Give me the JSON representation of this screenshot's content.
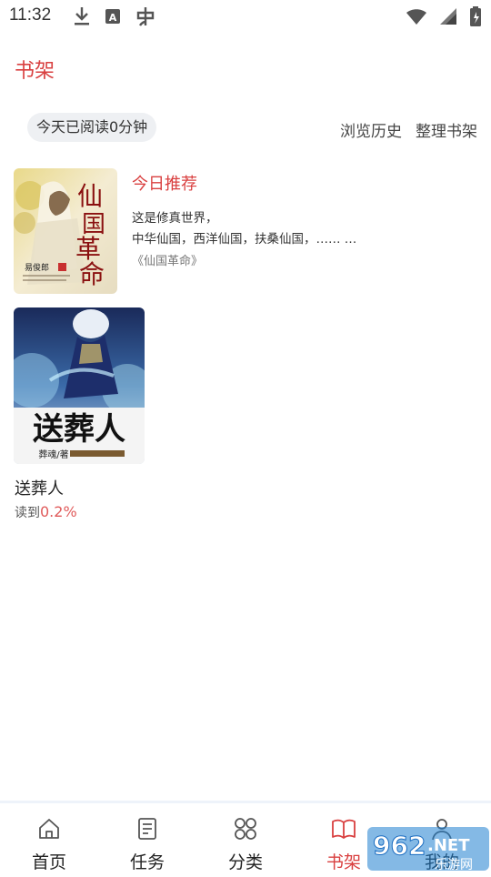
{
  "status_bar": {
    "time": "11:32",
    "left_icons": [
      "download-icon",
      "font-icon",
      "bug-icon"
    ],
    "right_icons": [
      "wifi-icon",
      "signal-icon",
      "battery-icon"
    ]
  },
  "header": {
    "title": "书架"
  },
  "reading_stats": {
    "text": "今天已阅读0分钟"
  },
  "top_links": {
    "history": "浏览历史",
    "organize": "整理书架"
  },
  "recommendation": {
    "heading": "今日推荐",
    "cover": {
      "title": "仙国革命",
      "author": "易俊郎"
    },
    "description_line1": "这是修真世界，",
    "description_line2": "中华仙国，西洋仙国，扶桑仙国，…… …",
    "book_name": "《仙国革命》"
  },
  "shelf": [
    {
      "title": "送葬人",
      "cover": {
        "title": "送葬人",
        "author": "葬魂/著"
      },
      "progress_prefix": "读到",
      "progress_value": "0.2%"
    }
  ],
  "nav": {
    "items": [
      {
        "label": "首页",
        "icon": "home-icon",
        "active": false
      },
      {
        "label": "任务",
        "icon": "task-list-icon",
        "active": false
      },
      {
        "label": "分类",
        "icon": "category-grid-icon",
        "active": false
      },
      {
        "label": "书架",
        "icon": "open-book-icon",
        "active": true
      },
      {
        "label": "我的",
        "icon": "profile-icon",
        "active": false
      }
    ]
  },
  "watermark": {
    "text1": "962",
    "text2": ".NET",
    "text3": "乐游网"
  },
  "colors": {
    "accent": "#d94040",
    "progress": "#e05a5a"
  }
}
